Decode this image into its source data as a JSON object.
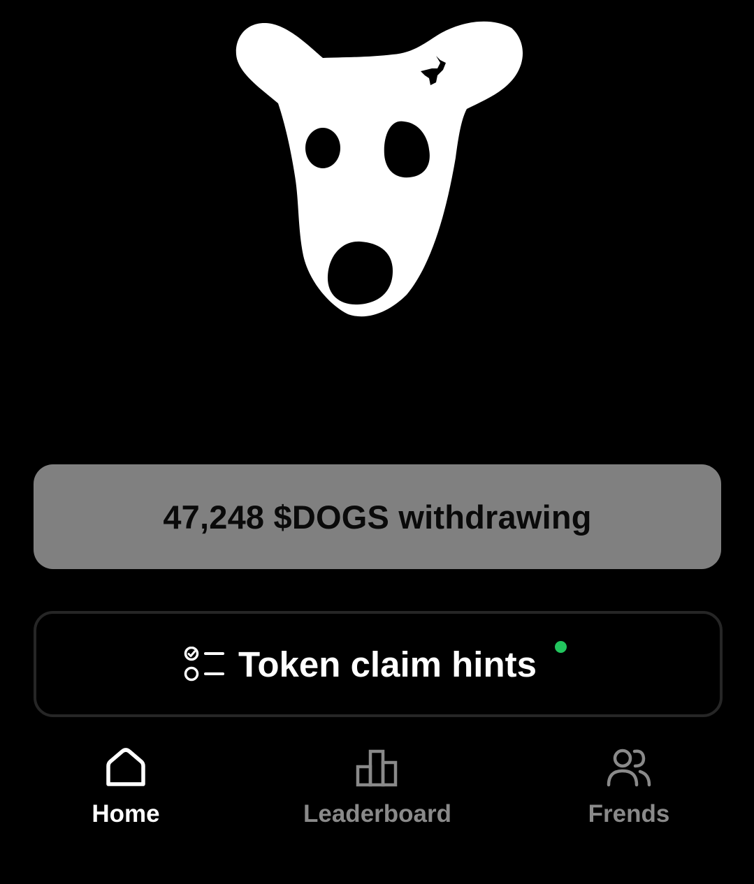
{
  "logo": {
    "icon": "dog-head-icon",
    "color": "#ffffff"
  },
  "withdraw": {
    "label": "47,248 $DOGS withdrawing",
    "background": "#808080"
  },
  "hints": {
    "icon": "checklist-icon",
    "label": "Token claim hints",
    "dot_color": "#22c55e"
  },
  "tabs": [
    {
      "label": "Home",
      "icon": "home-icon",
      "active": true
    },
    {
      "label": "Leaderboard",
      "icon": "leaderboard-icon",
      "active": false
    },
    {
      "label": "Frends",
      "icon": "friends-icon",
      "active": false
    }
  ],
  "colors": {
    "background": "#000000",
    "tab_active": "#ffffff",
    "tab_inactive": "#8a8a8a"
  }
}
